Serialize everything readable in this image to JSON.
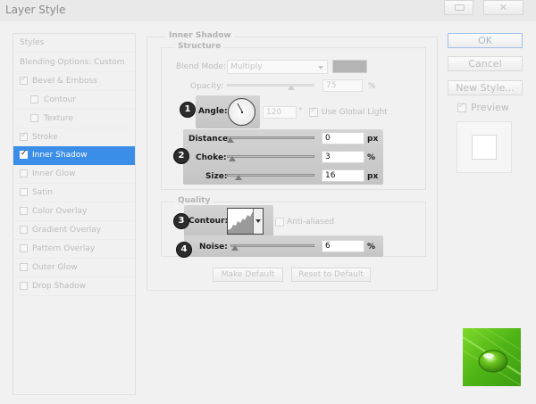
{
  "window": {
    "title": "Layer Style",
    "close_glyph": "✕"
  },
  "styles_list": {
    "header": "Styles",
    "blending": "Blending Options: Custom",
    "items": [
      {
        "label": "Bevel & Emboss",
        "checked": true
      },
      {
        "label": "Contour",
        "checked": false
      },
      {
        "label": "Texture",
        "checked": false
      },
      {
        "label": "Stroke",
        "checked": true
      },
      {
        "label": "Inner Shadow",
        "checked": true,
        "selected": true
      },
      {
        "label": "Inner Glow",
        "checked": false
      },
      {
        "label": "Satin",
        "checked": false
      },
      {
        "label": "Color Overlay",
        "checked": false
      },
      {
        "label": "Gradient Overlay",
        "checked": false
      },
      {
        "label": "Pattern Overlay",
        "checked": false
      },
      {
        "label": "Outer Glow",
        "checked": false
      },
      {
        "label": "Drop Shadow",
        "checked": false
      }
    ]
  },
  "inner_shadow": {
    "title": "Inner Shadow",
    "structure": "Structure",
    "blend_mode_label": "Blend Mode:",
    "blend_mode_value": "Multiply",
    "opacity_label": "Opacity:",
    "opacity_value": "75",
    "opacity_unit": "%",
    "angle_label": "Angle:",
    "angle_value": "120",
    "angle_unit": "°",
    "use_global_light": "Use Global Light",
    "distance_label": "Distance:",
    "distance_value": "0",
    "distance_unit": "px",
    "choke_label": "Choke:",
    "choke_value": "3",
    "choke_unit": "%",
    "size_label": "Size:",
    "size_value": "16",
    "size_unit": "px",
    "quality": "Quality",
    "contour_label": "Contour:",
    "anti_aliased": "Anti-aliased",
    "noise_label": "Noise:",
    "noise_value": "6",
    "noise_unit": "%",
    "make_default": "Make Default",
    "reset_default": "Reset to Default"
  },
  "buttons": {
    "ok": "OK",
    "cancel": "Cancel",
    "new_style": "New Style...",
    "preview": "Preview"
  },
  "badges": [
    "1",
    "2",
    "3",
    "4"
  ],
  "colors": {
    "selected": "#3b8ee8",
    "shadow_color": "#b4b4b4",
    "leaf_green": "#5cc21c"
  }
}
